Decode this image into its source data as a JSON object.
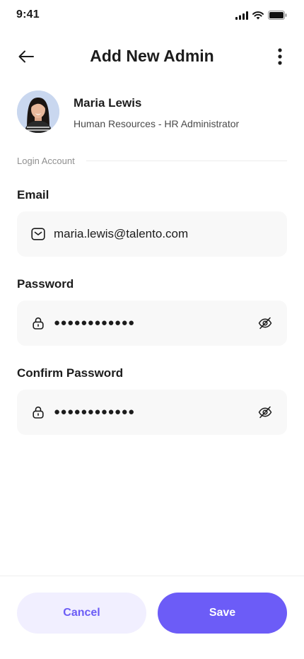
{
  "status": {
    "time": "9:41"
  },
  "header": {
    "title": "Add New Admin",
    "back_icon": "arrow-left-icon",
    "menu_icon": "more-vertical-icon"
  },
  "profile": {
    "name": "Maria Lewis",
    "role": "Human Resources - HR Administrator"
  },
  "section": {
    "label": "Login Account"
  },
  "form": {
    "email": {
      "label": "Email",
      "value": "maria.lewis@talento.com",
      "icon": "mail-icon"
    },
    "password": {
      "label": "Password",
      "value": "●●●●●●●●●●●●",
      "icon": "lock-icon",
      "toggle_icon": "eye-off-icon"
    },
    "confirm_password": {
      "label": "Confirm Password",
      "value": "●●●●●●●●●●●●",
      "icon": "lock-icon",
      "toggle_icon": "eye-off-icon"
    }
  },
  "actions": {
    "cancel_label": "Cancel",
    "save_label": "Save"
  },
  "colors": {
    "accent": "#6c5cf7",
    "accent_soft": "#f1efff",
    "field_bg": "#f8f8f8"
  }
}
